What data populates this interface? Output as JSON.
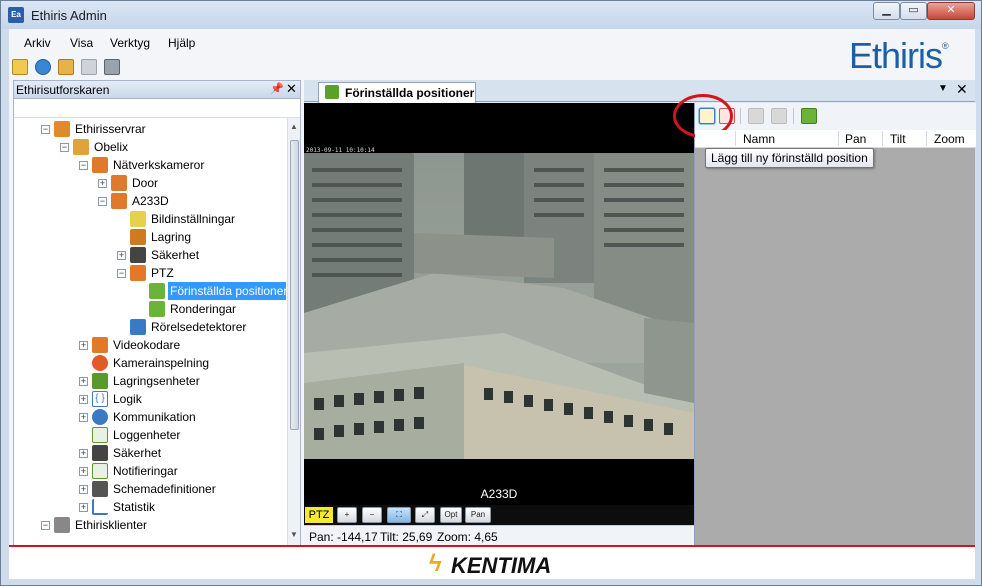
{
  "window": {
    "title": "Ethiris Admin",
    "icon_text": "Ea"
  },
  "menu": [
    {
      "label": "Arkiv"
    },
    {
      "label": "Visa"
    },
    {
      "label": "Verktyg"
    },
    {
      "label": "Hjälp"
    }
  ],
  "toolbar_icons": [
    "new-icon",
    "settings-icon",
    "open-folder-icon",
    "save-icon",
    "save-all-icon"
  ],
  "logo": {
    "text": "Ethiris",
    "mark": "®",
    "color": "#1c5fa6"
  },
  "explorer": {
    "title": "Ethirisutforskaren",
    "tree": [
      {
        "label": "Ethirisservrar",
        "icon": "server-group-icon",
        "color": "#e08a2a"
      },
      {
        "label": "Obelix",
        "icon": "server-icon",
        "color": "#e0a23a"
      },
      {
        "label": "Nätverkskameror",
        "icon": "camera-group-icon",
        "color": "#e07a2a"
      },
      {
        "label": "Door",
        "icon": "camera-icon",
        "color": "#e07a2a"
      },
      {
        "label": "A233D",
        "icon": "camera-icon",
        "color": "#e07a2a"
      },
      {
        "label": "Bildinställningar",
        "icon": "image-settings-icon",
        "color": "#e6d24a"
      },
      {
        "label": "Lagring",
        "icon": "storage-icon",
        "color": "#d07a20"
      },
      {
        "label": "Säkerhet",
        "icon": "lock-icon",
        "color": "#444444"
      },
      {
        "label": "PTZ",
        "icon": "ptz-icon",
        "color": "#e07a2a"
      },
      {
        "label": "Förinställda positioner",
        "icon": "preset-positions-icon",
        "color": "#6cb33a"
      },
      {
        "label": "Ronderingar",
        "icon": "patrol-icon",
        "color": "#6cb33a"
      },
      {
        "label": "Rörelsedetektorer",
        "icon": "motion-detector-icon",
        "color": "#3a7ac4"
      },
      {
        "label": "Videokodare",
        "icon": "video-encoder-icon",
        "color": "#e07a2a"
      },
      {
        "label": "Kamerainspelning",
        "icon": "camera-recording-icon",
        "color": "#e05a2a"
      },
      {
        "label": "Lagringsenheter",
        "icon": "storage-units-icon",
        "color": "#5a9a2a"
      },
      {
        "label": "Logik",
        "icon": "logic-icon",
        "color": "#3a7ac4"
      },
      {
        "label": "Kommunikation",
        "icon": "communication-icon",
        "color": "#3a7ac4"
      },
      {
        "label": "Loggenheter",
        "icon": "log-units-icon",
        "color": "#5a9a2a"
      },
      {
        "label": "Säkerhet",
        "icon": "security-icon",
        "color": "#444444"
      },
      {
        "label": "Notifieringar",
        "icon": "notifications-icon",
        "color": "#5a9a2a"
      },
      {
        "label": "Schemadefinitioner",
        "icon": "schedule-icon",
        "color": "#555555"
      },
      {
        "label": "Statistik",
        "icon": "statistics-icon",
        "color": "#3a7ac4"
      },
      {
        "label": "Ethirisklienter",
        "icon": "client-group-icon",
        "color": "#888888"
      }
    ]
  },
  "document_tab": {
    "label": "Förinställda positioner"
  },
  "video": {
    "timestamp": "2013-09-11 10:10:14",
    "camera_name": "A233D",
    "ptz_label": "PTZ",
    "ptz_buttons": [
      {
        "name": "zoom-in-button",
        "label": "+"
      },
      {
        "name": "zoom-out-button",
        "label": "−"
      },
      {
        "name": "fit-button",
        "label": "⛶"
      },
      {
        "name": "fullscreen-button",
        "label": "⤢"
      },
      {
        "name": "opt-button",
        "label": "Opt"
      },
      {
        "name": "pan-button",
        "label": "Pan"
      }
    ],
    "status": {
      "pan": "Pan: -144,17",
      "tilt": "Tilt: 25,69",
      "zoom": "Zoom: 4,65"
    }
  },
  "presets": {
    "columns": [
      "Namn",
      "Pan",
      "Tilt",
      "Zoom"
    ],
    "tooltip": "Lägg till ny förinställd position",
    "toolbar": [
      "add-preset-icon",
      "delete-preset-icon",
      "move-up-icon",
      "move-down-icon",
      "goto-preset-icon"
    ]
  },
  "footer": {
    "brand": "KENTIMA",
    "accent": "#d4141c"
  }
}
